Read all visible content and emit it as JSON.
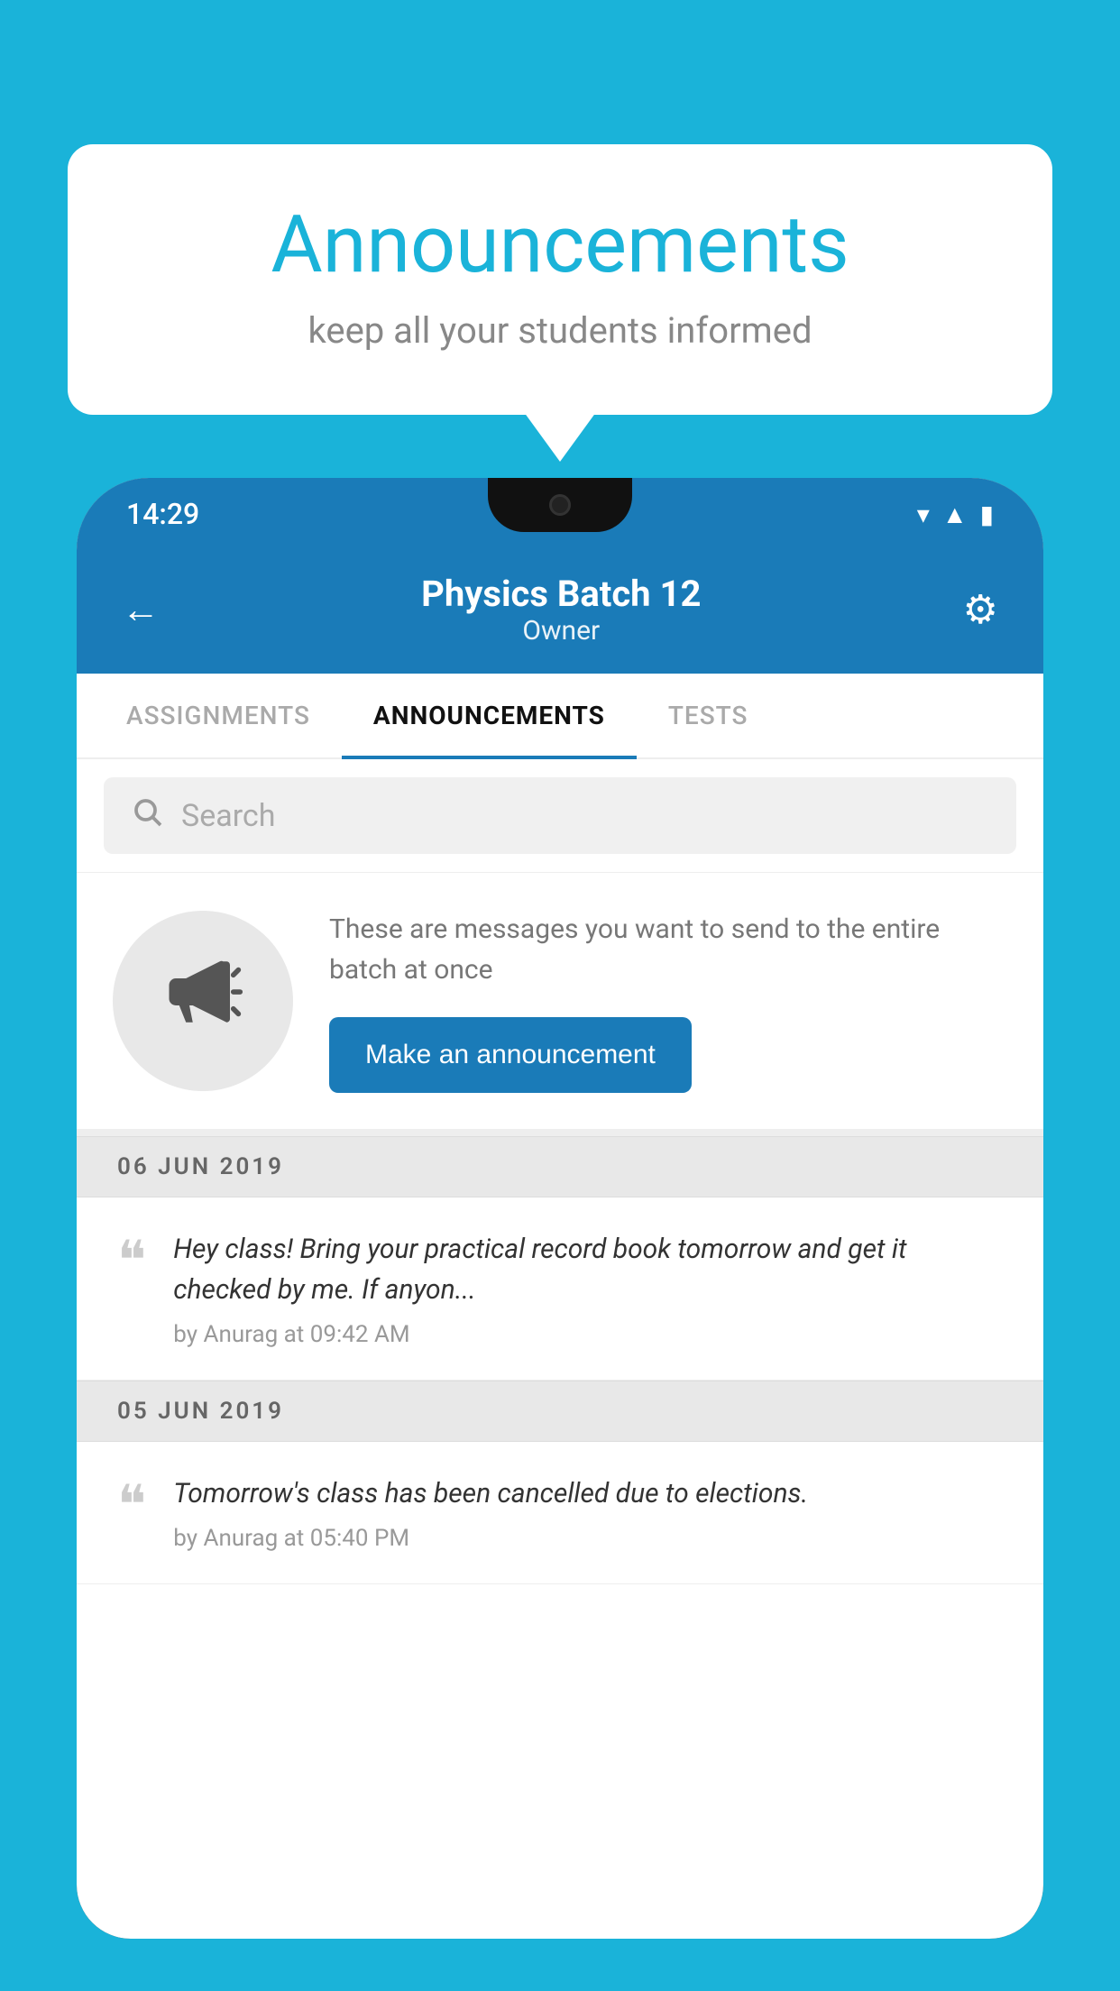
{
  "background_color": "#1ab3d9",
  "speech_bubble": {
    "title": "Announcements",
    "subtitle": "keep all your students informed"
  },
  "phone": {
    "status_bar": {
      "time": "14:29"
    },
    "header": {
      "title": "Physics Batch 12",
      "subtitle": "Owner",
      "back_label": "←",
      "gear_label": "⚙"
    },
    "tabs": [
      {
        "label": "ASSIGNMENTS",
        "active": false
      },
      {
        "label": "ANNOUNCEMENTS",
        "active": true
      },
      {
        "label": "TESTS",
        "active": false
      }
    ],
    "search": {
      "placeholder": "Search"
    },
    "promo": {
      "description": "These are messages you want to send to the entire batch at once",
      "button_label": "Make an announcement"
    },
    "announcements": [
      {
        "date": "06  JUN  2019",
        "message": "Hey class! Bring your practical record book tomorrow and get it checked by me. If anyon...",
        "meta": "by Anurag at 09:42 AM"
      },
      {
        "date": "05  JUN  2019",
        "message": "Tomorrow's class has been cancelled due to elections.",
        "meta": "by Anurag at 05:40 PM"
      }
    ]
  }
}
